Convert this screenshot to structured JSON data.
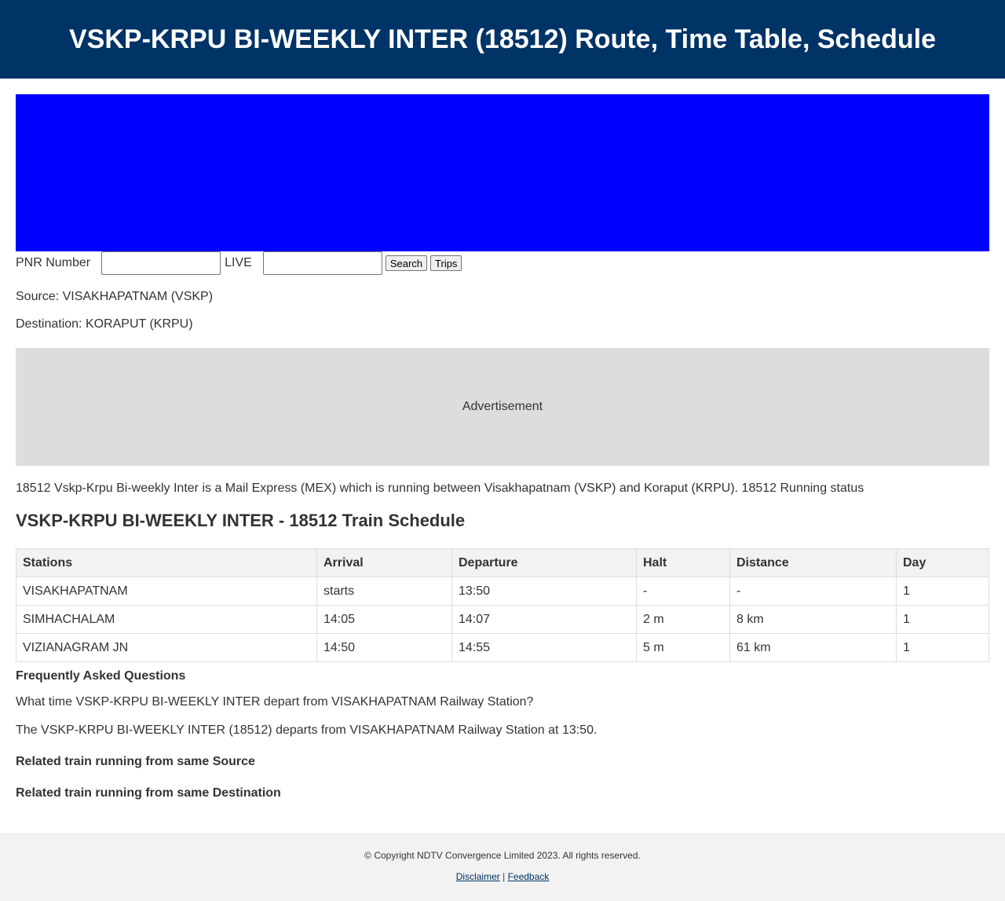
{
  "header": {
    "title": "VSKP-KRPU BI-WEEKLY INTER (18512) Route, Time Table, Schedule"
  },
  "banner": {
    "color": "#0000ff"
  },
  "search": {
    "pnr_label": "PNR Number",
    "pnr_value": "",
    "live_label": "LIVE",
    "live_value": "",
    "search_button": "Search",
    "trips_button": "Trips"
  },
  "route": {
    "source": "Source: VISAKHAPATNAM (VSKP)",
    "destination": "Destination: KORAPUT (KRPU)"
  },
  "ad": {
    "label": "Advertisement"
  },
  "description": "18512 Vskp-Krpu Bi-weekly Inter is a Mail Express (MEX) which is running between Visakhapatnam (VSKP) and Koraput (KRPU). 18512 Running status",
  "schedule": {
    "title": "VSKP-KRPU BI-WEEKLY INTER - 18512 Train Schedule",
    "columns": [
      "Stations",
      "Arrival",
      "Departure",
      "Halt",
      "Distance",
      "Day"
    ],
    "rows": [
      [
        "VISAKHAPATNAM",
        "starts",
        "13:50",
        "-",
        "-",
        "1"
      ],
      [
        "SIMHACHALAM",
        "14:05",
        "14:07",
        "2 m",
        "8 km",
        "1"
      ],
      [
        "VIZIANAGRAM JN",
        "14:50",
        "14:55",
        "5 m",
        "61 km",
        "1"
      ]
    ]
  },
  "faq": {
    "title": "Frequently Asked Questions",
    "question": "What time VSKP-KRPU BI-WEEKLY INTER depart from VISAKHAPATNAM Railway Station?",
    "answer": "The VSKP-KRPU BI-WEEKLY INTER (18512) departs from VISAKHAPATNAM Railway Station at 13:50."
  },
  "related": {
    "source": "Related train running from same Source",
    "destination": "Related train running from same Destination"
  },
  "footer": {
    "copyright": "© Copyright NDTV Convergence Limited 2023. All rights reserved.",
    "disclaimer": "Disclaimer",
    "separator": "|",
    "feedback": "Feedback"
  },
  "colors": {
    "header_bg": "#003366",
    "banner_bg": "#0000ff",
    "ad_bg": "#dddddd",
    "footer_bg": "#f2f2f2"
  }
}
